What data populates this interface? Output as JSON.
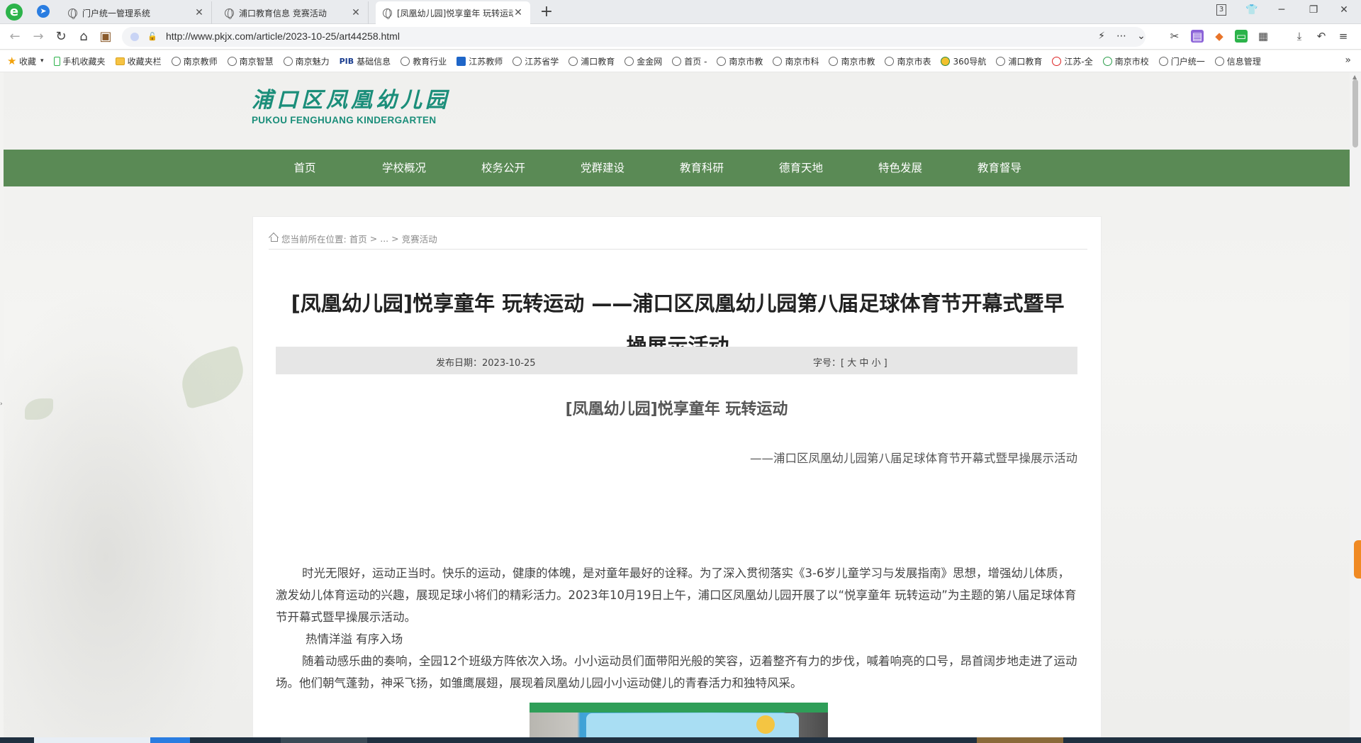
{
  "tabs": [
    {
      "label": "门户统一管理系统",
      "active": false
    },
    {
      "label": "浦口教育信息 竞赛活动",
      "active": false
    },
    {
      "label": "[凤凰幼儿园]悦享童年 玩转运动",
      "active": true
    }
  ],
  "tab_count_badge": "3",
  "address": {
    "url": "http://www.pkjx.com/article/2023-10-25/art44258.html"
  },
  "bookmarks": [
    {
      "label": "收藏",
      "icon": "star"
    },
    {
      "label": "手机收藏夹",
      "icon": "phone"
    },
    {
      "label": "收藏夹栏",
      "icon": "folder"
    },
    {
      "label": "南京教师",
      "icon": "seal"
    },
    {
      "label": "南京智慧",
      "icon": "circle"
    },
    {
      "label": "南京魅力",
      "icon": "globe"
    },
    {
      "label": "基础信息",
      "icon": "pib",
      "prefix": "PIB"
    },
    {
      "label": "教育行业",
      "icon": "globe"
    },
    {
      "label": "江苏教师",
      "icon": "blue"
    },
    {
      "label": "江苏省学",
      "icon": "globe"
    },
    {
      "label": "浦口教育",
      "icon": "globe"
    },
    {
      "label": "金金网",
      "icon": "globe"
    },
    {
      "label": "首页 -",
      "icon": "globe"
    },
    {
      "label": "南京市教",
      "icon": "globe"
    },
    {
      "label": "南京市科",
      "icon": "globe"
    },
    {
      "label": "南京市教",
      "icon": "globe"
    },
    {
      "label": "南京市表",
      "icon": "globe"
    },
    {
      "label": "360导航",
      "icon": "yellow"
    },
    {
      "label": "浦口教育",
      "icon": "globe"
    },
    {
      "label": "江苏-全",
      "icon": "red"
    },
    {
      "label": "南京市校",
      "icon": "green"
    },
    {
      "label": "门户统一",
      "icon": "globe"
    },
    {
      "label": "信息管理",
      "icon": "globe"
    }
  ],
  "site": {
    "logo_cn": "浦口区凤凰幼儿园",
    "logo_en": "PUKOU FENGHUANG KINDERGARTEN"
  },
  "nav": [
    "首页",
    "学校概况",
    "校务公开",
    "党群建设",
    "教育科研",
    "德育天地",
    "特色发展",
    "教育督导"
  ],
  "breadcrumb": {
    "prefix": "您当前所在位置:",
    "home": "首页",
    "sep1": ">",
    "ellipsis": "...",
    "sep2": ">",
    "current": "竞赛活动"
  },
  "article": {
    "title": "[凤凰幼儿园]悦享童年 玩转运动 ——浦口区凤凰幼儿园第八届足球体育节开幕式暨早操展示活动",
    "date": "发布日期：2023-10-25",
    "font_size": "字号：[ 大 中 小 ]",
    "subtitle": "[凤凰幼儿园]悦享童年 玩转运动",
    "subline": "——浦口区凤凰幼儿园第八届足球体育节开幕式暨早操展示活动",
    "para1": "时光无限好，运动正当时。快乐的运动，健康的体魄，是对童年最好的诠释。为了深入贯彻落实《3-6岁儿童学习与发展指南》思想，增强幼儿体质，激发幼儿体育运动的兴趣，展现足球小将们的精彩活力。2023年10月19日上午，浦口区凤凰幼儿园开展了以“悦享童年 玩转运动”为主题的第八届足球体育节开幕式暨早操展示活动。",
    "heading1": "热情洋溢 有序入场",
    "para2": "随着动感乐曲的奏响，全园12个班级方阵依次入场。小小运动员们面带阳光般的笑容，迈着整齐有力的步伐，喊着响亮的口号，昂首阔步地走进了运动场。他们朝气蓬勃，神采飞扬，如雏鹰展翅，展现着凤凰幼儿园小小运动健儿的青春活力和独特风采。"
  },
  "colors": {
    "nav_green": "#5a8a55",
    "logo_teal": "#1b8e7a",
    "meta_bar": "#e6e6e6"
  }
}
